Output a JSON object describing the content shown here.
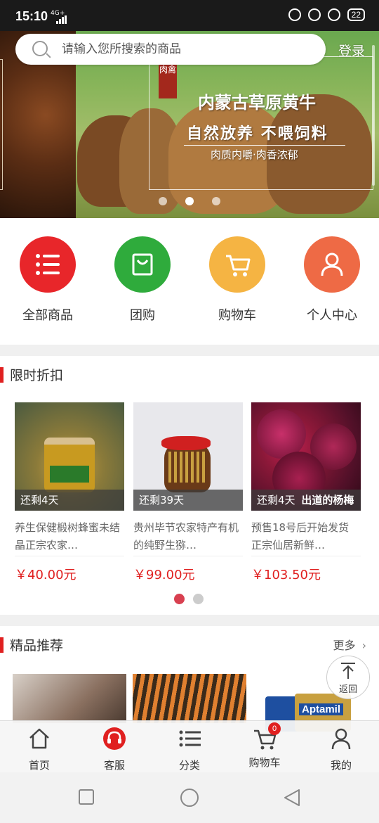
{
  "status_bar": {
    "time": "15:10",
    "signal": "4G+",
    "battery": "22"
  },
  "search": {
    "placeholder": "请输入您所搜索的商品",
    "login_label": "登录"
  },
  "banner": {
    "tag": "肉禽",
    "title": "内蒙古草原黄牛",
    "subtitle": "自然放养 不喂饲料",
    "tagline": "肉质内嚼·肉香浓郁",
    "slide_count": 3,
    "active_slide": 2
  },
  "categories": [
    {
      "label": "全部商品",
      "icon": "list-icon",
      "color": "#e8262a"
    },
    {
      "label": "团购",
      "icon": "bag-icon",
      "color": "#2fab3c"
    },
    {
      "label": "购物车",
      "icon": "cart-icon",
      "color": "#f5b443"
    },
    {
      "label": "个人中心",
      "icon": "user-icon",
      "color": "#ee6a45"
    }
  ],
  "flash_sale": {
    "title": "限时折扣",
    "products": [
      {
        "remaining": "还剩4天",
        "name": "养生保健椴树蜂蜜未结晶正宗农家…",
        "price": "￥40.00元"
      },
      {
        "remaining": "还剩39天",
        "name": "贵州毕节农家特产有机的纯野生猕…",
        "price": "￥99.00元"
      },
      {
        "remaining": "还剩4天",
        "name": "预售18号后开始发货 正宗仙居新鲜…",
        "price": "￥103.50元",
        "overlay": "出道的杨梅"
      }
    ],
    "pages": 2,
    "active_page": 1
  },
  "recommend": {
    "title": "精品推荐",
    "more_label": "更多",
    "brand_text": "Aptamil"
  },
  "back_top": {
    "label": "返回"
  },
  "tabbar": {
    "items": [
      {
        "label": "首页",
        "icon": "home-icon"
      },
      {
        "label": "客服",
        "icon": "headset-icon"
      },
      {
        "label": "分类",
        "icon": "category-list-icon"
      },
      {
        "label": "购物车",
        "icon": "cart-icon",
        "badge": "0"
      },
      {
        "label": "我的",
        "icon": "person-icon"
      }
    ]
  },
  "colors": {
    "accent_red": "#e02020",
    "cat_red": "#e8262a",
    "cat_green": "#2fab3c",
    "cat_yellow": "#f5b443",
    "cat_orange": "#ee6a45"
  }
}
